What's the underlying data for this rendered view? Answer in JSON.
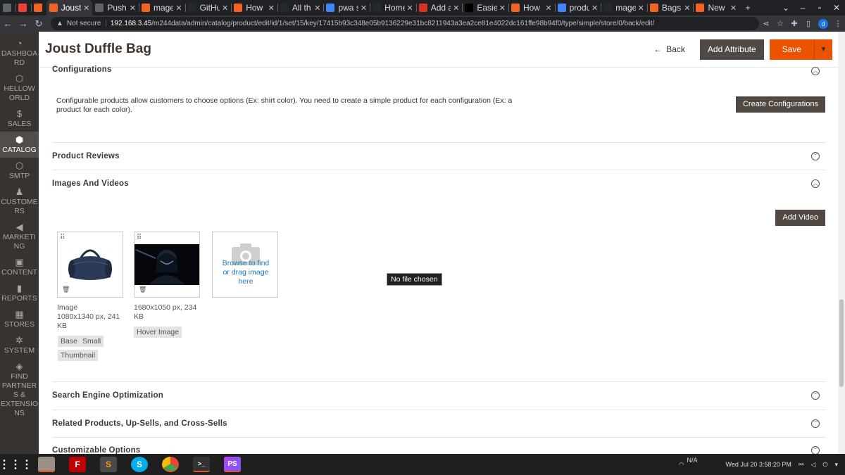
{
  "browser": {
    "tabs": [
      {
        "label": "",
        "color": "#5f6368"
      },
      {
        "label": "",
        "color": "#ea4335"
      },
      {
        "label": "",
        "color": "#f26322"
      },
      {
        "label": "Joust",
        "color": "#f26322",
        "active": true
      },
      {
        "label": "Push",
        "color": "#5f6368"
      },
      {
        "label": "mage",
        "color": "#f26322"
      },
      {
        "label": "GitHu",
        "color": "#24292e"
      },
      {
        "label": "How",
        "color": "#f26322"
      },
      {
        "label": "All th",
        "color": "#24292e"
      },
      {
        "label": "pwa s",
        "color": "#4285f4"
      },
      {
        "label": "Home",
        "color": "#24292e"
      },
      {
        "label": "Add a",
        "color": "#d93025"
      },
      {
        "label": "Easie",
        "color": "#000000"
      },
      {
        "label": "How",
        "color": "#f26322"
      },
      {
        "label": "produ",
        "color": "#4285f4"
      },
      {
        "label": "mage",
        "color": "#24292e"
      },
      {
        "label": "Bags",
        "color": "#f26322"
      },
      {
        "label": "New",
        "color": "#f26322"
      }
    ],
    "new_tab": "+",
    "address": {
      "not_secure": "Not secure",
      "host": "192.168.3.45",
      "path": "/m244data/admin/catalog/product/edit/id/1/set/15/key/17415b93c348e05b9136229e31bc8211943a3ea2ce81e4022dc161ffe98b94f0/type/simple/store/0/back/edit/"
    },
    "profile_initial": "d"
  },
  "sidebar": {
    "items": [
      {
        "label": "DASHBOA RD",
        "icon": "dashboard-icon",
        "glyph": "◔"
      },
      {
        "label": "HELLOW ORLD",
        "icon": "hexagon-icon",
        "glyph": "⬡"
      },
      {
        "label": "SALES",
        "icon": "dollar-icon",
        "glyph": "$"
      },
      {
        "label": "CATALOG",
        "icon": "cube-icon",
        "glyph": "⬢",
        "active": true
      },
      {
        "label": "SMTP",
        "icon": "hexagon-icon",
        "glyph": "⬡"
      },
      {
        "label": "CUSTOME RS",
        "icon": "person-icon",
        "glyph": "♟"
      },
      {
        "label": "MARKETI NG",
        "icon": "megaphone-icon",
        "glyph": "◀"
      },
      {
        "label": "CONTENT",
        "icon": "content-icon",
        "glyph": "▣"
      },
      {
        "label": "REPORTS",
        "icon": "bar-chart-icon",
        "glyph": "▮"
      },
      {
        "label": "STORES",
        "icon": "store-icon",
        "glyph": "▦"
      },
      {
        "label": "SYSTEM",
        "icon": "gear-icon",
        "glyph": "✲"
      },
      {
        "label": "FIND PARTNER S & EXTENSIO NS",
        "icon": "box-icon",
        "glyph": "◈"
      }
    ]
  },
  "header": {
    "title": "Joust Duffle Bag",
    "back_label": "Back",
    "add_attribute_label": "Add Attribute",
    "save_label": "Save"
  },
  "configurations": {
    "title": "Configurations",
    "description": "Configurable products allow customers to choose options (Ex: shirt color). You need to create a simple product for each configuration (Ex: a product for each color).",
    "button": "Create Configurations"
  },
  "sections": {
    "product_reviews": "Product Reviews",
    "images_videos": "Images And Videos",
    "seo": "Search Engine Optimization",
    "related": "Related Products, Up-Sells, and Cross-Sells",
    "custom_options": "Customizable Options"
  },
  "images": {
    "add_video": "Add Video",
    "items": [
      {
        "line1": "Image",
        "line2": "1080x1340 px, 241",
        "line3": "KB",
        "roles": [
          "Base",
          "Small",
          "Thumbnail"
        ]
      },
      {
        "line1": "1680x1050 px, 234",
        "line2": "KB",
        "roles": [
          "Hover Image"
        ]
      }
    ],
    "upload_text": "Browse to find or drag image here",
    "no_file": "No file chosen"
  },
  "taskbar": {
    "network": "N/A",
    "clock": "Wed Jul 20   3:58:20 PM"
  }
}
